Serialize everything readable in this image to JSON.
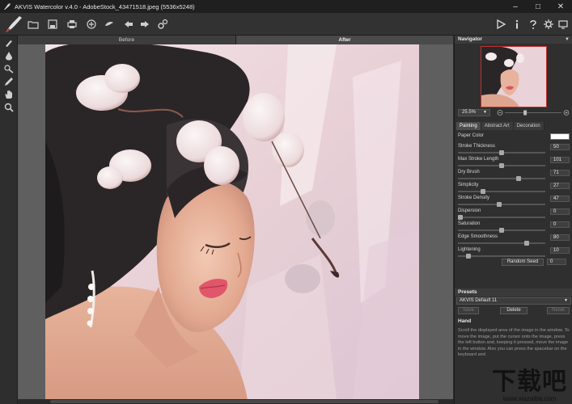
{
  "window": {
    "title": "AKVIS Watercolor v.4.0 - AdobeStock_43471518.jpeg (5536x5248)",
    "controls": [
      "minimize",
      "maximize",
      "close"
    ]
  },
  "toolbar": {
    "left_icons": [
      "open-icon",
      "save-icon",
      "print-icon",
      "share-icon",
      "batch-icon",
      "undo-icon",
      "redo-icon",
      "settings-gear-icon"
    ],
    "right_icons": [
      "run-icon",
      "info-icon",
      "help-icon",
      "preferences-icon",
      "fullscreen-icon"
    ]
  },
  "tools": [
    "brush-icon",
    "drop-icon",
    "smudge-icon",
    "pencil-icon",
    "hand-icon",
    "zoom-icon"
  ],
  "canvas": {
    "tab_before": "Before",
    "tab_after": "After"
  },
  "navigator": {
    "title": "Navigator",
    "zoom": "25.5%",
    "zoom_level": 0.35
  },
  "settings": {
    "tabs": [
      "Painting",
      "Abstract Art",
      "Decoration"
    ],
    "active_tab": "Painting",
    "paper_color_label": "Paper Color",
    "paper_color": "#ffffff",
    "params": [
      {
        "label": "Stroke Thickness",
        "value": "50",
        "fraction": 0.5
      },
      {
        "label": "Max Stroke Length",
        "value": "101",
        "fraction": 0.5
      },
      {
        "label": "Dry Brush",
        "value": "71",
        "fraction": 0.71
      },
      {
        "label": "Simplicity",
        "value": "27",
        "fraction": 0.27
      },
      {
        "label": "Stroke Density",
        "value": "47",
        "fraction": 0.47
      },
      {
        "label": "Dispersion",
        "value": "0",
        "fraction": 0.0
      },
      {
        "label": "Saturation",
        "value": "0",
        "fraction": 0.5
      },
      {
        "label": "Edge Smoothness",
        "value": "80",
        "fraction": 0.8
      },
      {
        "label": "Lightening",
        "value": "10",
        "fraction": 0.1
      }
    ],
    "random_seed_label": "Random Seed",
    "random_seed_value": "0"
  },
  "presets": {
    "title": "Presets",
    "selected": "AKVIS Default 11",
    "save_label": "Save",
    "delete_label": "Delete",
    "reset_label": "Reset"
  },
  "hint": {
    "title": "Hand",
    "text": "Scroll the displayed area of the image in the window. To move the image, put the cursor onto the image, press the left button and, keeping it pressed, move the image in the window. Also you can press the spacebar on the keyboard and"
  },
  "watermark": {
    "brand": "下载吧",
    "url": "www.xiazaiba.com"
  },
  "colors": {
    "accent": "#c03030",
    "panel_bg": "#2f2f2f",
    "canvas_bg": "#5f5f5f"
  }
}
